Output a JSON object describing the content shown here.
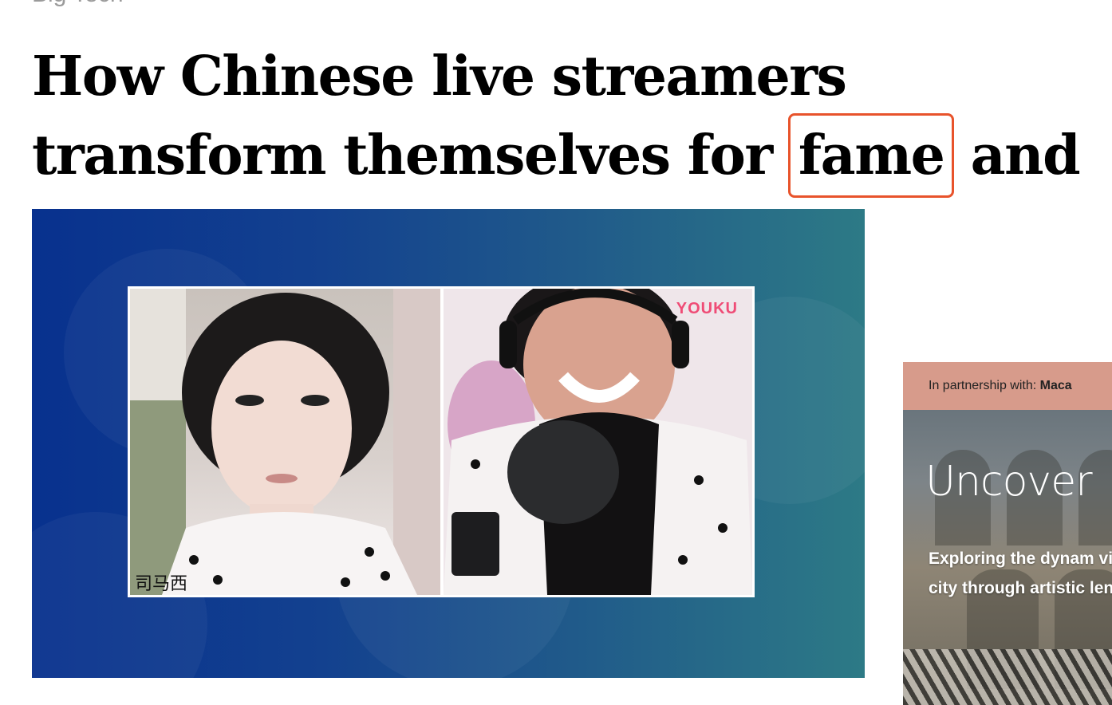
{
  "section": {
    "label": "Big Tech"
  },
  "article": {
    "headline_before": "How Chinese live streamers transform themselves for",
    "headline_highlight": "fame",
    "headline_after": "and money",
    "highlight_color": "#e8532b"
  },
  "hero_image": {
    "watermark": "YOUKU",
    "caption_partial": "司马西"
  },
  "ad": {
    "partner_prefix": "In partnership with:",
    "partner_name": "Maca",
    "title": "Uncover",
    "description": "Exploring the dynam vibrant city through artistic lens"
  }
}
